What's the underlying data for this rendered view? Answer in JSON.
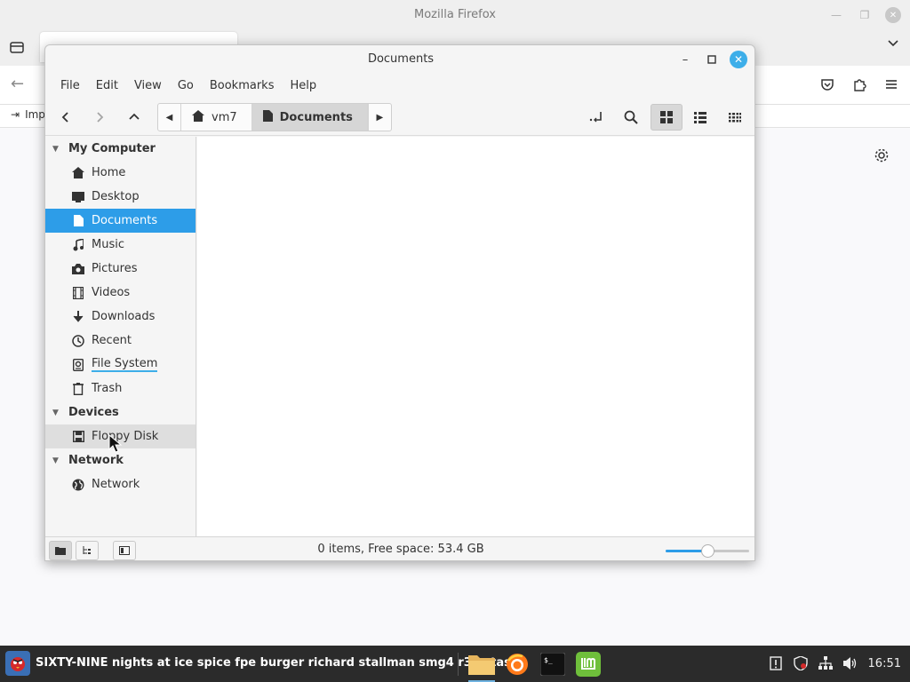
{
  "firefox": {
    "title": "Mozilla Firefox",
    "bookmark_partial": "Imp"
  },
  "nemo": {
    "title": "Documents",
    "menu": [
      "File",
      "Edit",
      "View",
      "Go",
      "Bookmarks",
      "Help"
    ],
    "pathbar": [
      {
        "label": "vm7",
        "icon": "home-icon"
      },
      {
        "label": "Documents",
        "icon": "document-icon",
        "current": true
      }
    ],
    "sidebar": {
      "sections": [
        {
          "header": "My Computer",
          "items": [
            {
              "label": "Home",
              "icon": "home-icon"
            },
            {
              "label": "Desktop",
              "icon": "desktop-icon"
            },
            {
              "label": "Documents",
              "icon": "document-icon",
              "selected": true
            },
            {
              "label": "Music",
              "icon": "music-icon"
            },
            {
              "label": "Pictures",
              "icon": "camera-icon"
            },
            {
              "label": "Videos",
              "icon": "film-icon"
            },
            {
              "label": "Downloads",
              "icon": "download-icon"
            },
            {
              "label": "Recent",
              "icon": "clock-icon"
            },
            {
              "label": "File System",
              "icon": "drive-icon"
            },
            {
              "label": "Trash",
              "icon": "trash-icon"
            }
          ]
        },
        {
          "header": "Devices",
          "items": [
            {
              "label": "Floppy Disk",
              "icon": "floppy-icon",
              "hover": true
            }
          ]
        },
        {
          "header": "Network",
          "items": [
            {
              "label": "Network",
              "icon": "globe-icon"
            }
          ]
        }
      ]
    },
    "status_text": "0 items, Free space: 53.4 GB",
    "zoom_level": 0.5
  },
  "taskbar": {
    "window_title": "SIXTY-NINE nights at ice spice fpe burger richard stallman smg4 r34 stash",
    "clock": "16:51",
    "apps": [
      "files-icon",
      "firefox-icon",
      "terminal-icon",
      "mint-icon"
    ]
  },
  "colors": {
    "accent": "#2d9de8",
    "close_button": "#3daee9",
    "taskbar": "#2b2b2b"
  }
}
